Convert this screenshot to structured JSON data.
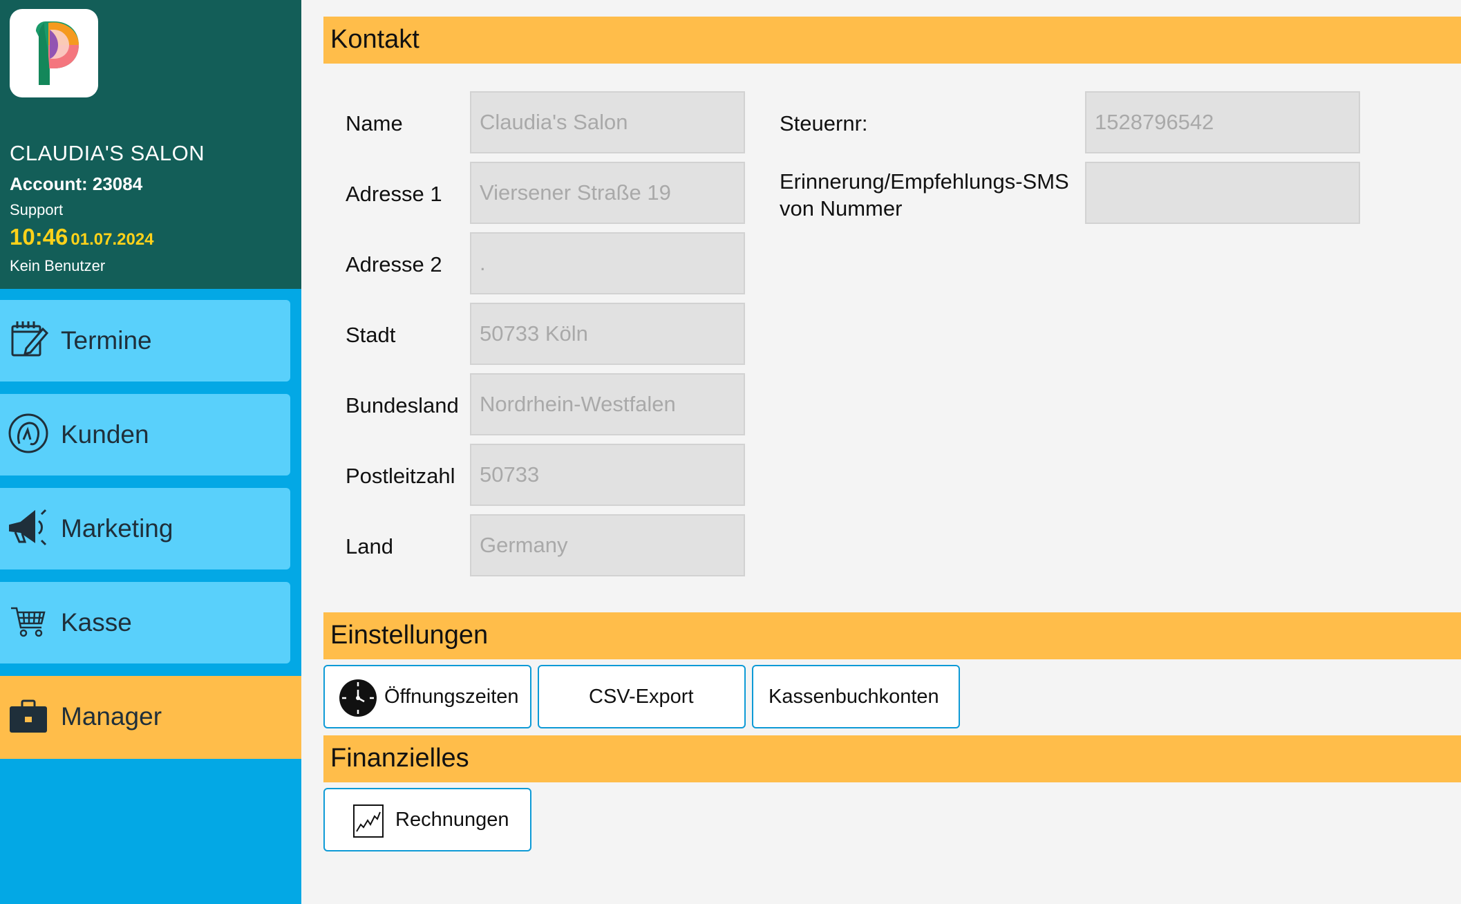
{
  "sidebar": {
    "salon_name": "CLAUDIA'S SALON",
    "account": "Account: 23084",
    "support": "Support",
    "time": "10:46",
    "date": "01.07.2024",
    "user": "Kein Benutzer",
    "nav": [
      {
        "label": "Termine",
        "icon": "calendar-edit-icon"
      },
      {
        "label": "Kunden",
        "icon": "customer-head-icon"
      },
      {
        "label": "Marketing",
        "icon": "megaphone-icon"
      },
      {
        "label": "Kasse",
        "icon": "shopping-cart-icon"
      },
      {
        "label": "Manager",
        "icon": "briefcase-icon",
        "active": true
      }
    ]
  },
  "contact": {
    "title": "Kontakt",
    "fields": {
      "name": {
        "label": "Name",
        "value": "Claudia's Salon"
      },
      "address1": {
        "label": "Adresse 1",
        "value": "Viersener Straße 19"
      },
      "address2": {
        "label": "Adresse 2",
        "value": "."
      },
      "city": {
        "label": "Stadt",
        "value": "50733 Köln"
      },
      "state": {
        "label": "Bundesland",
        "value": "Nordrhein-Westfalen"
      },
      "zip": {
        "label": "Postleitzahl",
        "value": "50733"
      },
      "country": {
        "label": "Land",
        "value": "Germany"
      },
      "tax": {
        "label": "Steuernr:",
        "value": "1528796542"
      },
      "sms": {
        "label_line1": "Erinnerung/Empfehlungs-SMS",
        "label_line2": "von Nummer",
        "value": ""
      }
    }
  },
  "settings": {
    "title": "Einstellungen",
    "opening_hours": "Öffnungszeiten",
    "csv_export": "CSV-Export",
    "cashbook": "Kassenbuchkonten"
  },
  "finance": {
    "title": "Finanzielles",
    "invoices": "Rechnungen"
  },
  "colors": {
    "sidebar_dark": "#135e58",
    "sidebar_blue": "#03a8e5",
    "nav_light": "#59d0fb",
    "accent_orange": "#ffbd4a",
    "time_yellow": "#ffd21a"
  }
}
